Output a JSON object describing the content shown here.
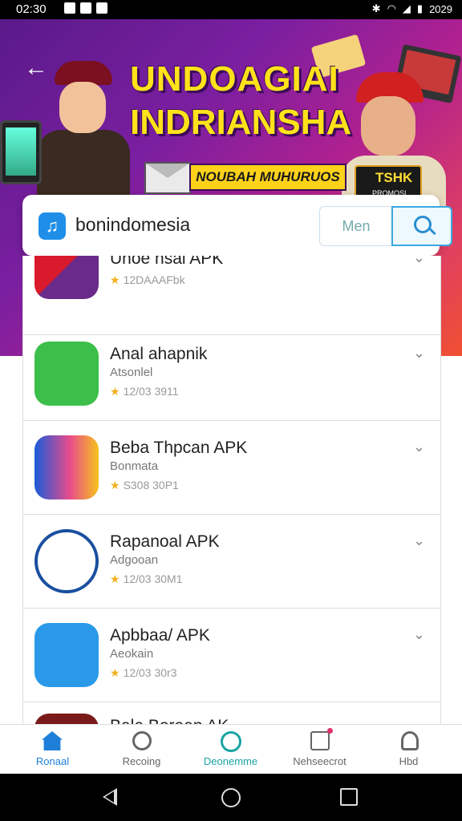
{
  "status_bar": {
    "time": "02:30",
    "right_text": "2029"
  },
  "banner": {
    "title_line1": "UNDOAGIAI",
    "title_line2": "INDRIANSHA",
    "ribbon_text": "NOUBAH MUHURUOS",
    "badge_title": "TSHK",
    "badge_sub": "PROMOSI"
  },
  "search": {
    "query": "bonindomesia",
    "ghost_label": "Men"
  },
  "apps": [
    {
      "name": "Unoe nsai APK",
      "subtitle": "",
      "rating": "12DAAAFbk"
    },
    {
      "name": "Anal ahapnik",
      "subtitle": "Atsonlel",
      "rating": "12/03 3911"
    },
    {
      "name": "Beba Thpcan APK",
      "subtitle": "Bonmata",
      "rating": "S308 30P1"
    },
    {
      "name": "Rapanoal APK",
      "subtitle": "Adgooan",
      "rating": "12/03 30M1"
    },
    {
      "name": "Apbbaa/ APK",
      "subtitle": "Aeokain",
      "rating": "12/03 30r3"
    },
    {
      "name": "Bale Borean AK",
      "subtitle": "",
      "rating": ""
    }
  ],
  "nav": [
    {
      "label": "Ronaal",
      "icon": "home-icon"
    },
    {
      "label": "Recoing",
      "icon": "compass-icon"
    },
    {
      "label": "Deonemme",
      "icon": "leaf-icon"
    },
    {
      "label": "Nehseecrot",
      "icon": "notification-icon"
    },
    {
      "label": "Hbd",
      "icon": "profile-icon"
    }
  ],
  "colors": {
    "accent": "#1e7fd8",
    "banner_start": "#5a1a8a",
    "banner_end": "#f05030",
    "title_yellow": "#ffe21a"
  }
}
